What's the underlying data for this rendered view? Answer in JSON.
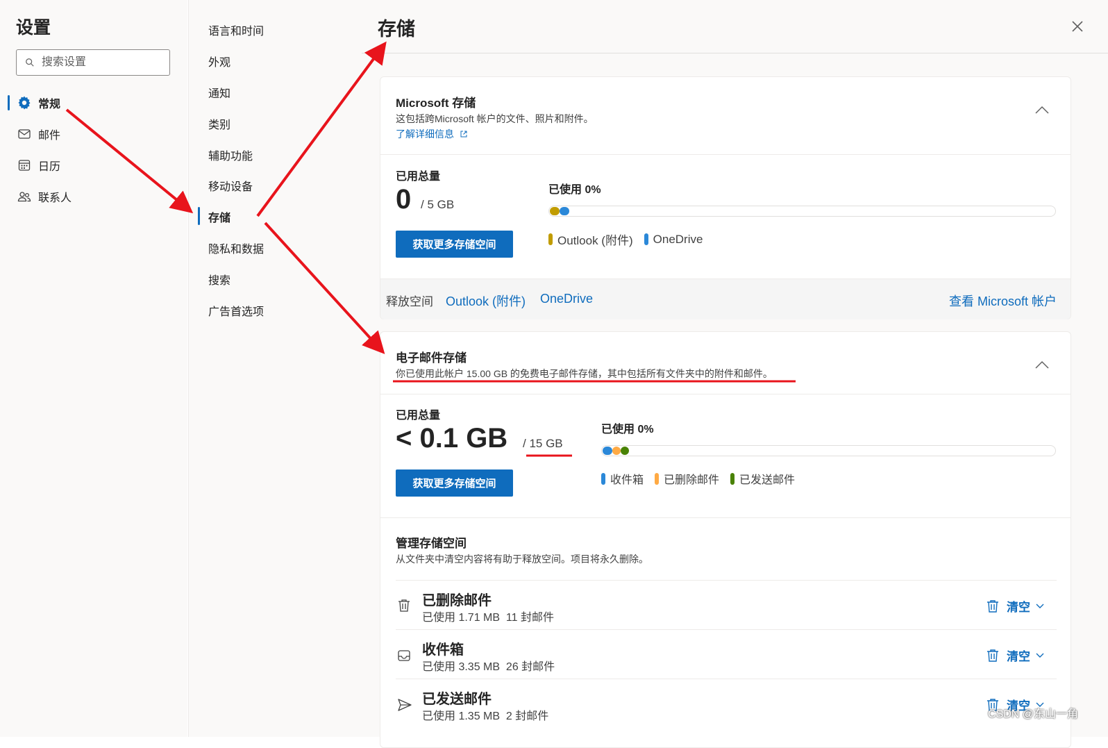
{
  "settings_title": "设置",
  "search": {
    "placeholder": "搜索设置"
  },
  "primary_nav": [
    {
      "label": "常规",
      "icon": "gear-icon",
      "active": true
    },
    {
      "label": "邮件",
      "icon": "mail-icon"
    },
    {
      "label": "日历",
      "icon": "calendar-icon"
    },
    {
      "label": "联系人",
      "icon": "people-icon"
    }
  ],
  "secondary_nav": [
    {
      "label": "语言和时间"
    },
    {
      "label": "外观"
    },
    {
      "label": "通知"
    },
    {
      "label": "类别"
    },
    {
      "label": "辅助功能"
    },
    {
      "label": "移动设备"
    },
    {
      "label": "存储",
      "active": true
    },
    {
      "label": "隐私和数据"
    },
    {
      "label": "搜索"
    },
    {
      "label": "广告首选项"
    }
  ],
  "page_title": "存储",
  "microsoft_storage": {
    "title": "Microsoft 存储",
    "description": "这包括跨Microsoft 帐户的文件、照片和附件。",
    "learn_more": "了解详细信息",
    "total_label": "已用总量",
    "used_value": "0",
    "capacity": "/ 5 GB",
    "used_percent_label": "已使用 0%",
    "button_label": "获取更多存储空间",
    "legend": [
      {
        "label": "Outlook (附件)",
        "color": "#c19c00"
      },
      {
        "label": "OneDrive",
        "color": "#2b88d8"
      }
    ],
    "free_up_label": "释放空间",
    "free_up_links": [
      "Outlook (附件)",
      "OneDrive"
    ],
    "view_account": "查看 Microsoft 帐户"
  },
  "email_storage": {
    "title": "电子邮件存储",
    "description": "你已使用此帐户 15.00 GB 的免费电子邮件存储，其中包括所有文件夹中的附件和邮件。",
    "total_label": "已用总量",
    "used_value": "< 0.1 GB",
    "capacity": "/ 15 GB",
    "used_percent_label": "已使用 0%",
    "button_label": "获取更多存储空间",
    "legend": [
      {
        "label": "收件箱",
        "color": "#2b88d8"
      },
      {
        "label": "已删除邮件",
        "color": "#ffaa44"
      },
      {
        "label": "已发送邮件",
        "color": "#498205"
      }
    ]
  },
  "manage_storage": {
    "title": "管理存储空间",
    "description": "从文件夹中清空内容将有助于释放空间。项目将永久删除。",
    "folders": [
      {
        "name": "已删除邮件",
        "icon": "trash-icon",
        "stats": "已使用 1.71 MB  11 封邮件",
        "action": "清空"
      },
      {
        "name": "收件箱",
        "icon": "inbox-icon",
        "stats": "已使用 3.35 MB  26 封邮件",
        "action": "清空"
      },
      {
        "name": "已发送邮件",
        "icon": "send-icon",
        "stats": "已使用 1.35 MB  2 封邮件",
        "action": "清空"
      }
    ]
  },
  "watermark": "CSDN @东山一角",
  "annotation_color": "#e8141c"
}
